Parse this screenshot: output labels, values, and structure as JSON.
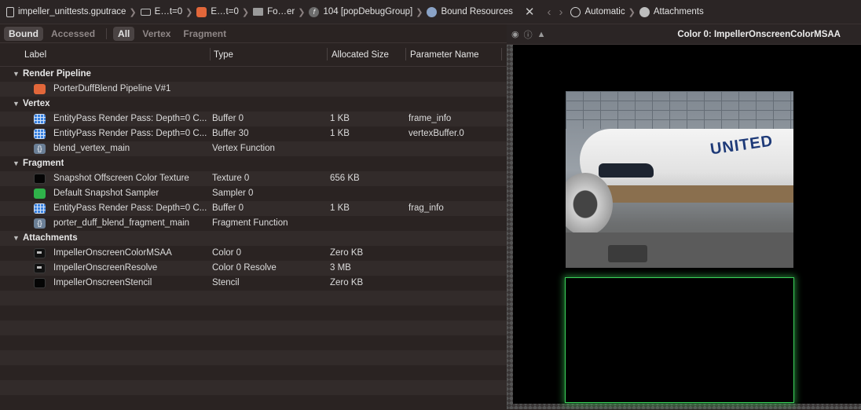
{
  "breadcrumbs": [
    {
      "label": "impeller_unittests.gputrace",
      "icon": "document-icon"
    },
    {
      "label": "E…t=0",
      "icon": "tray-icon"
    },
    {
      "label": "E…t=0",
      "icon": "image-icon"
    },
    {
      "label": "Fo…er",
      "icon": "folder-icon"
    },
    {
      "label": "104 [popDebugGroup]",
      "icon": "function-icon"
    },
    {
      "label": "Bound Resources",
      "icon": "cube-icon"
    }
  ],
  "toolbar": {
    "close_glyph": "✕",
    "nav_glyphs": "‹›",
    "automatic_label": "Automatic",
    "attachments_label": "Attachments"
  },
  "filters": {
    "scope": [
      "Bound",
      "Accessed"
    ],
    "kind": [
      "All",
      "Vertex",
      "Fragment"
    ],
    "selected_scope": "Bound",
    "selected_kind": "All"
  },
  "columns": {
    "label": "Label",
    "type": "Type",
    "size": "Allocated Size",
    "param": "Parameter Name"
  },
  "groups": [
    {
      "name": "Render Pipeline",
      "rows": [
        {
          "icon": "pipeline-icon",
          "label": "PorterDuffBlend Pipeline V#1",
          "type": "",
          "size": "",
          "param": ""
        }
      ]
    },
    {
      "name": "Vertex",
      "rows": [
        {
          "icon": "buffer-icon",
          "label": "EntityPass Render Pass: Depth=0 C...",
          "type": "Buffer 0",
          "size": "1 KB",
          "param": "frame_info"
        },
        {
          "icon": "buffer-icon",
          "label": "EntityPass Render Pass: Depth=0 C...",
          "type": "Buffer 30",
          "size": "1 KB",
          "param": "vertexBuffer.0"
        },
        {
          "icon": "function-braces-icon",
          "label": "blend_vertex_main",
          "type": "Vertex Function",
          "size": "",
          "param": ""
        }
      ]
    },
    {
      "name": "Fragment",
      "rows": [
        {
          "icon": "texture-icon",
          "label": "Snapshot Offscreen Color Texture",
          "type": "Texture 0",
          "size": "656 KB",
          "param": ""
        },
        {
          "icon": "sampler-icon",
          "label": "Default Snapshot Sampler",
          "type": "Sampler 0",
          "size": "",
          "param": ""
        },
        {
          "icon": "buffer-icon",
          "label": "EntityPass Render Pass: Depth=0 C...",
          "type": "Buffer 0",
          "size": "1 KB",
          "param": "frag_info"
        },
        {
          "icon": "function-braces-icon",
          "label": "porter_duff_blend_fragment_main",
          "type": "Fragment Function",
          "size": "",
          "param": ""
        }
      ]
    },
    {
      "name": "Attachments",
      "rows": [
        {
          "icon": "attachment-thumbnail-icon",
          "label": "ImpellerOnscreenColorMSAA",
          "type": "Color 0",
          "size": "Zero KB",
          "param": ""
        },
        {
          "icon": "attachment-thumbnail-icon",
          "label": "ImpellerOnscreenResolve",
          "type": "Color 0 Resolve",
          "size": "3 MB",
          "param": ""
        },
        {
          "icon": "texture-icon",
          "label": "ImpellerOnscreenStencil",
          "type": "Stencil",
          "size": "Zero KB",
          "param": ""
        }
      ]
    }
  ],
  "viewer": {
    "title": "Color 0: ImpellerOnscreenColorMSAA",
    "image_text": "UNITED",
    "selection_color": "#3bd45b"
  },
  "colors": {
    "background": "#2a2322",
    "row_alt": "#322b2a",
    "buffer_icon": "#3a82e0",
    "pipeline_icon": "#e2673a",
    "sampler_icon": "#2fb24a"
  }
}
